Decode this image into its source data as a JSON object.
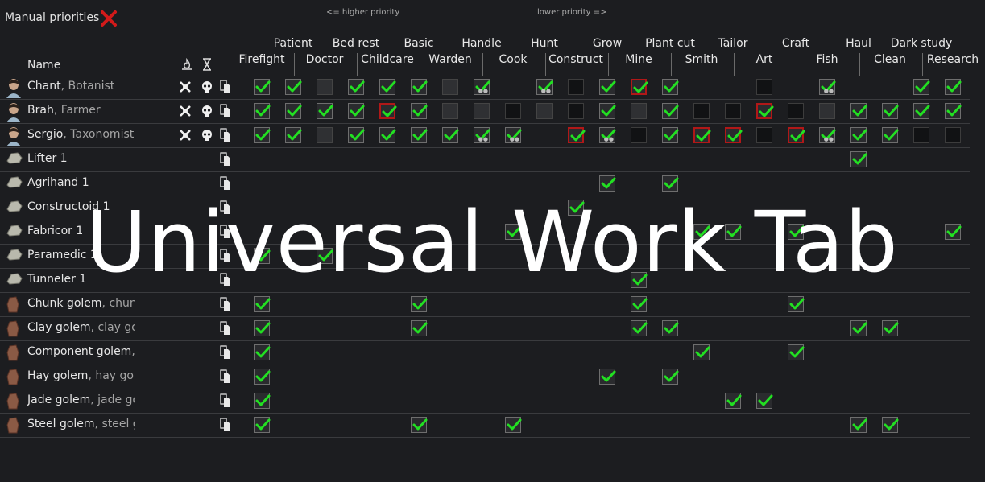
{
  "header": {
    "title": "Manual priorities",
    "higher_priority": "<= higher priority",
    "lower_priority": "lower priority =>",
    "name_column": "Name"
  },
  "watermark": "Universal Work Tab",
  "columns": [
    "Firefight",
    "Patient",
    "Doctor",
    "Bed rest",
    "Childcare",
    "Basic",
    "Warden",
    "Handle",
    "Cook",
    "Hunt",
    "Construct",
    "Grow",
    "Mine",
    "Plant cut",
    "Smith",
    "Tailor",
    "Art",
    "Craft",
    "Fish",
    "Haul",
    "Clean",
    "Dark study",
    "Research"
  ],
  "icons": {
    "close": "red-x-icon",
    "temperature": "flame-icon",
    "time": "hourglass-icon",
    "copy": "copy-paste-icon",
    "drafted": "crossed-swords-icon",
    "status": "skull-mask-icon"
  },
  "states_legend": {
    "on": "checked",
    "nr": "checked with skill dots",
    "em": "empty",
    "dk": "disabled dark",
    "gr": "disabled grey",
    "rd": "checked red border"
  },
  "rows": [
    {
      "name": "Chant",
      "sub": ", Botanist",
      "type": "colonist",
      "cells": [
        "on",
        "on",
        "gr",
        "on",
        "on",
        "on",
        "gr",
        "on2",
        "",
        "on2",
        "dk",
        "on",
        "rd",
        "on",
        "",
        "",
        "dk",
        "",
        "on2",
        "",
        "",
        "on",
        "on"
      ]
    },
    {
      "name": "Brah",
      "sub": ", Farmer",
      "type": "colonist",
      "cells": [
        "on",
        "on",
        "on",
        "on",
        "rd",
        "on",
        "gr",
        "gr",
        "dk",
        "gr",
        "dk",
        "on",
        "gr",
        "on",
        "dk",
        "dk",
        "rd",
        "dk",
        "gr",
        "on",
        "on",
        "on",
        "on"
      ]
    },
    {
      "name": "Sergio",
      "sub": ", Taxonomist",
      "type": "colonist",
      "cells": [
        "on",
        "on",
        "gr",
        "on",
        "on",
        "on",
        "on",
        "on2",
        "on2",
        "",
        "rd",
        "on2",
        "dk",
        "on",
        "rd",
        "rd",
        "dk",
        "rd",
        "on2",
        "on",
        "on",
        "dk",
        "dk"
      ]
    },
    {
      "name": "Lifter 1",
      "sub": "",
      "type": "mech",
      "cells": [
        "",
        "",
        "",
        "",
        "",
        "",
        "",
        "",
        "",
        "",
        "",
        "",
        "",
        "",
        "",
        "",
        "",
        "",
        "",
        "on",
        "",
        "",
        ""
      ]
    },
    {
      "name": "Agrihand 1",
      "sub": "",
      "type": "mech",
      "cells": [
        "",
        "",
        "",
        "",
        "",
        "",
        "",
        "",
        "",
        "",
        "",
        "on",
        "",
        "on",
        "",
        "",
        "",
        "",
        "",
        "",
        "",
        "",
        ""
      ]
    },
    {
      "name": "Constructoid 1",
      "sub": "",
      "type": "mech",
      "cells": [
        "",
        "",
        "",
        "",
        "",
        "",
        "",
        "",
        "",
        "",
        "on",
        "",
        "",
        "",
        "",
        "",
        "",
        "",
        "",
        "",
        "",
        "",
        ""
      ]
    },
    {
      "name": "Fabricor 1",
      "sub": "",
      "type": "mech",
      "cells": [
        "",
        "",
        "",
        "",
        "",
        "",
        "",
        "",
        "on",
        "",
        "",
        "",
        "",
        "",
        "on",
        "on",
        "",
        "on",
        "",
        "",
        "",
        "",
        "on"
      ]
    },
    {
      "name": "Paramedic 1",
      "sub": "",
      "type": "mech",
      "cells": [
        "on",
        "",
        "on",
        "",
        "",
        "",
        "",
        "",
        "",
        "",
        "",
        "",
        "",
        "",
        "",
        "",
        "",
        "",
        "",
        "",
        "",
        "",
        ""
      ]
    },
    {
      "name": "Tunneler 1",
      "sub": "",
      "type": "mech",
      "cells": [
        "",
        "",
        "",
        "",
        "",
        "",
        "",
        "",
        "",
        "",
        "",
        "",
        "on",
        "",
        "",
        "",
        "",
        "",
        "",
        "",
        "",
        "",
        ""
      ]
    },
    {
      "name": "Chunk golem",
      "sub": ", chunk",
      "type": "golem",
      "cells": [
        "on",
        "",
        "",
        "",
        "",
        "on",
        "",
        "",
        "",
        "",
        "",
        "",
        "on",
        "",
        "",
        "",
        "",
        "on",
        "",
        "",
        "",
        "",
        ""
      ]
    },
    {
      "name": "Clay golem",
      "sub": ", clay gole",
      "type": "golem",
      "cells": [
        "on",
        "",
        "",
        "",
        "",
        "on",
        "",
        "",
        "",
        "",
        "",
        "",
        "on",
        "on",
        "",
        "",
        "",
        "",
        "",
        "on",
        "on",
        "",
        ""
      ]
    },
    {
      "name": "Component golem",
      "sub": ", c",
      "type": "golem",
      "cells": [
        "on",
        "",
        "",
        "",
        "",
        "",
        "",
        "",
        "",
        "",
        "",
        "",
        "",
        "",
        "on",
        "",
        "",
        "on",
        "",
        "",
        "",
        "",
        ""
      ]
    },
    {
      "name": "Hay golem",
      "sub": ", hay golei",
      "type": "golem",
      "cells": [
        "on",
        "",
        "",
        "",
        "",
        "",
        "",
        "",
        "",
        "",
        "",
        "on",
        "",
        "on",
        "",
        "",
        "",
        "",
        "",
        "",
        "",
        "",
        ""
      ]
    },
    {
      "name": "Jade golem",
      "sub": ", jade gol",
      "type": "golem",
      "cells": [
        "on",
        "",
        "",
        "",
        "",
        "",
        "",
        "",
        "",
        "",
        "",
        "",
        "",
        "",
        "",
        "on",
        "on",
        "",
        "",
        "",
        "",
        "",
        ""
      ]
    },
    {
      "name": "Steel golem",
      "sub": ", steel go",
      "type": "golem",
      "cells": [
        "on",
        "",
        "",
        "",
        "",
        "on",
        "",
        "",
        "on",
        "",
        "",
        "",
        "",
        "",
        "",
        "",
        "",
        "",
        "",
        "on",
        "on",
        "",
        ""
      ]
    }
  ]
}
